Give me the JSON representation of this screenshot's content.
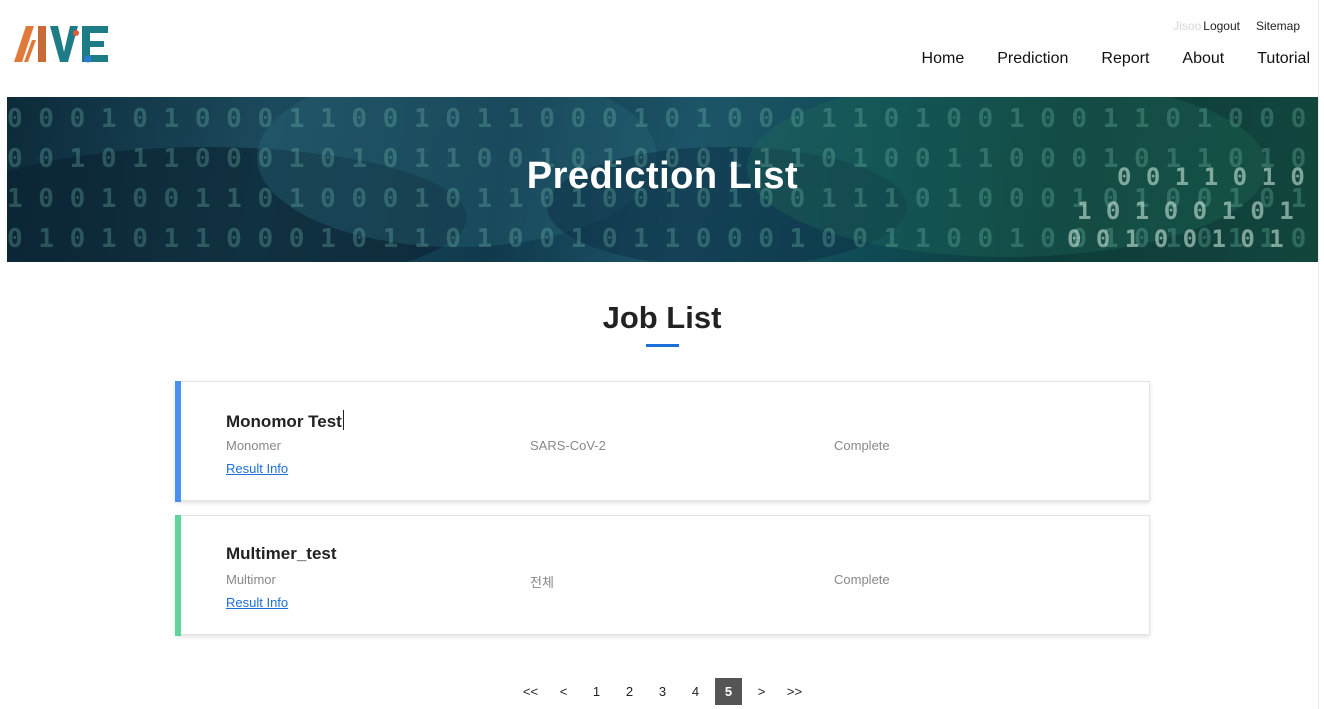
{
  "header": {
    "logo_text": "AIVE",
    "user_name": "Jisoo",
    "logout_label": "Logout",
    "sitemap_label": "Sitemap",
    "nav": [
      "Home",
      "Prediction",
      "Report",
      "About",
      "Tutorial"
    ]
  },
  "banner": {
    "title": "Prediction List"
  },
  "main": {
    "section_title": "Job List",
    "jobs": [
      {
        "name": "Monomor Test",
        "type": "Monomer",
        "target": "SARS-CoV-2",
        "status": "Complete",
        "link_label": "Result Info",
        "accent": "#4a8ff2"
      },
      {
        "name": "Multimer_test",
        "type": "Multimor",
        "target": "전체",
        "status": "Complete",
        "link_label": "Result Info",
        "accent": "#5fd49b"
      }
    ]
  },
  "pagination": {
    "first": "<<",
    "prev": "<",
    "pages": [
      "1",
      "2",
      "3",
      "4",
      "5"
    ],
    "current": "5",
    "next": ">",
    "last": ">>"
  },
  "colors": {
    "accent_blue": "#1a6fd8",
    "active_page": "#555555"
  }
}
